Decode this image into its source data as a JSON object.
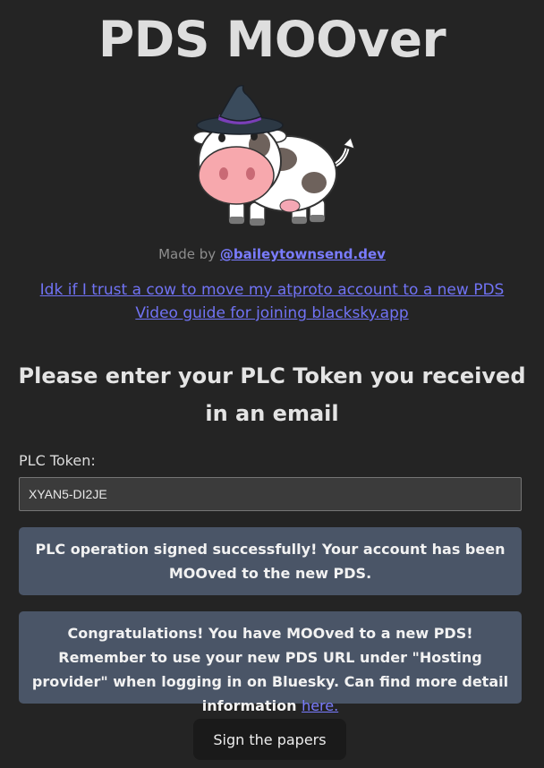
{
  "header": {
    "title": "PDS MOOver"
  },
  "credit": {
    "prefix": "Made by ",
    "author_link": "@baileytownsend.dev"
  },
  "links": [
    "Idk if I trust a cow to move my atproto account to a new PDS",
    "Video guide for joining blacksky.app"
  ],
  "form": {
    "heading": "Please enter your PLC Token you received in an email",
    "token_label": "PLC Token:",
    "token_value": "XYAN5-DI2JE",
    "submit_label": "Sign the papers"
  },
  "messages": {
    "success": "PLC operation signed successfully! Your account has been MOOved to the new PDS.",
    "congrats": "Congratulations! You have MOOved to a new PDS! Remember to use your new PDS URL under \"Hosting provider\" when logging in on Bluesky. Can find more detail information ",
    "congrats_link": "here."
  },
  "colors": {
    "background": "#242424",
    "link": "#7173f5",
    "message_box": "#4a5567",
    "button": "#1a1a1a"
  },
  "icons": {
    "mascot": "cow-with-witch-hat-illustration"
  }
}
